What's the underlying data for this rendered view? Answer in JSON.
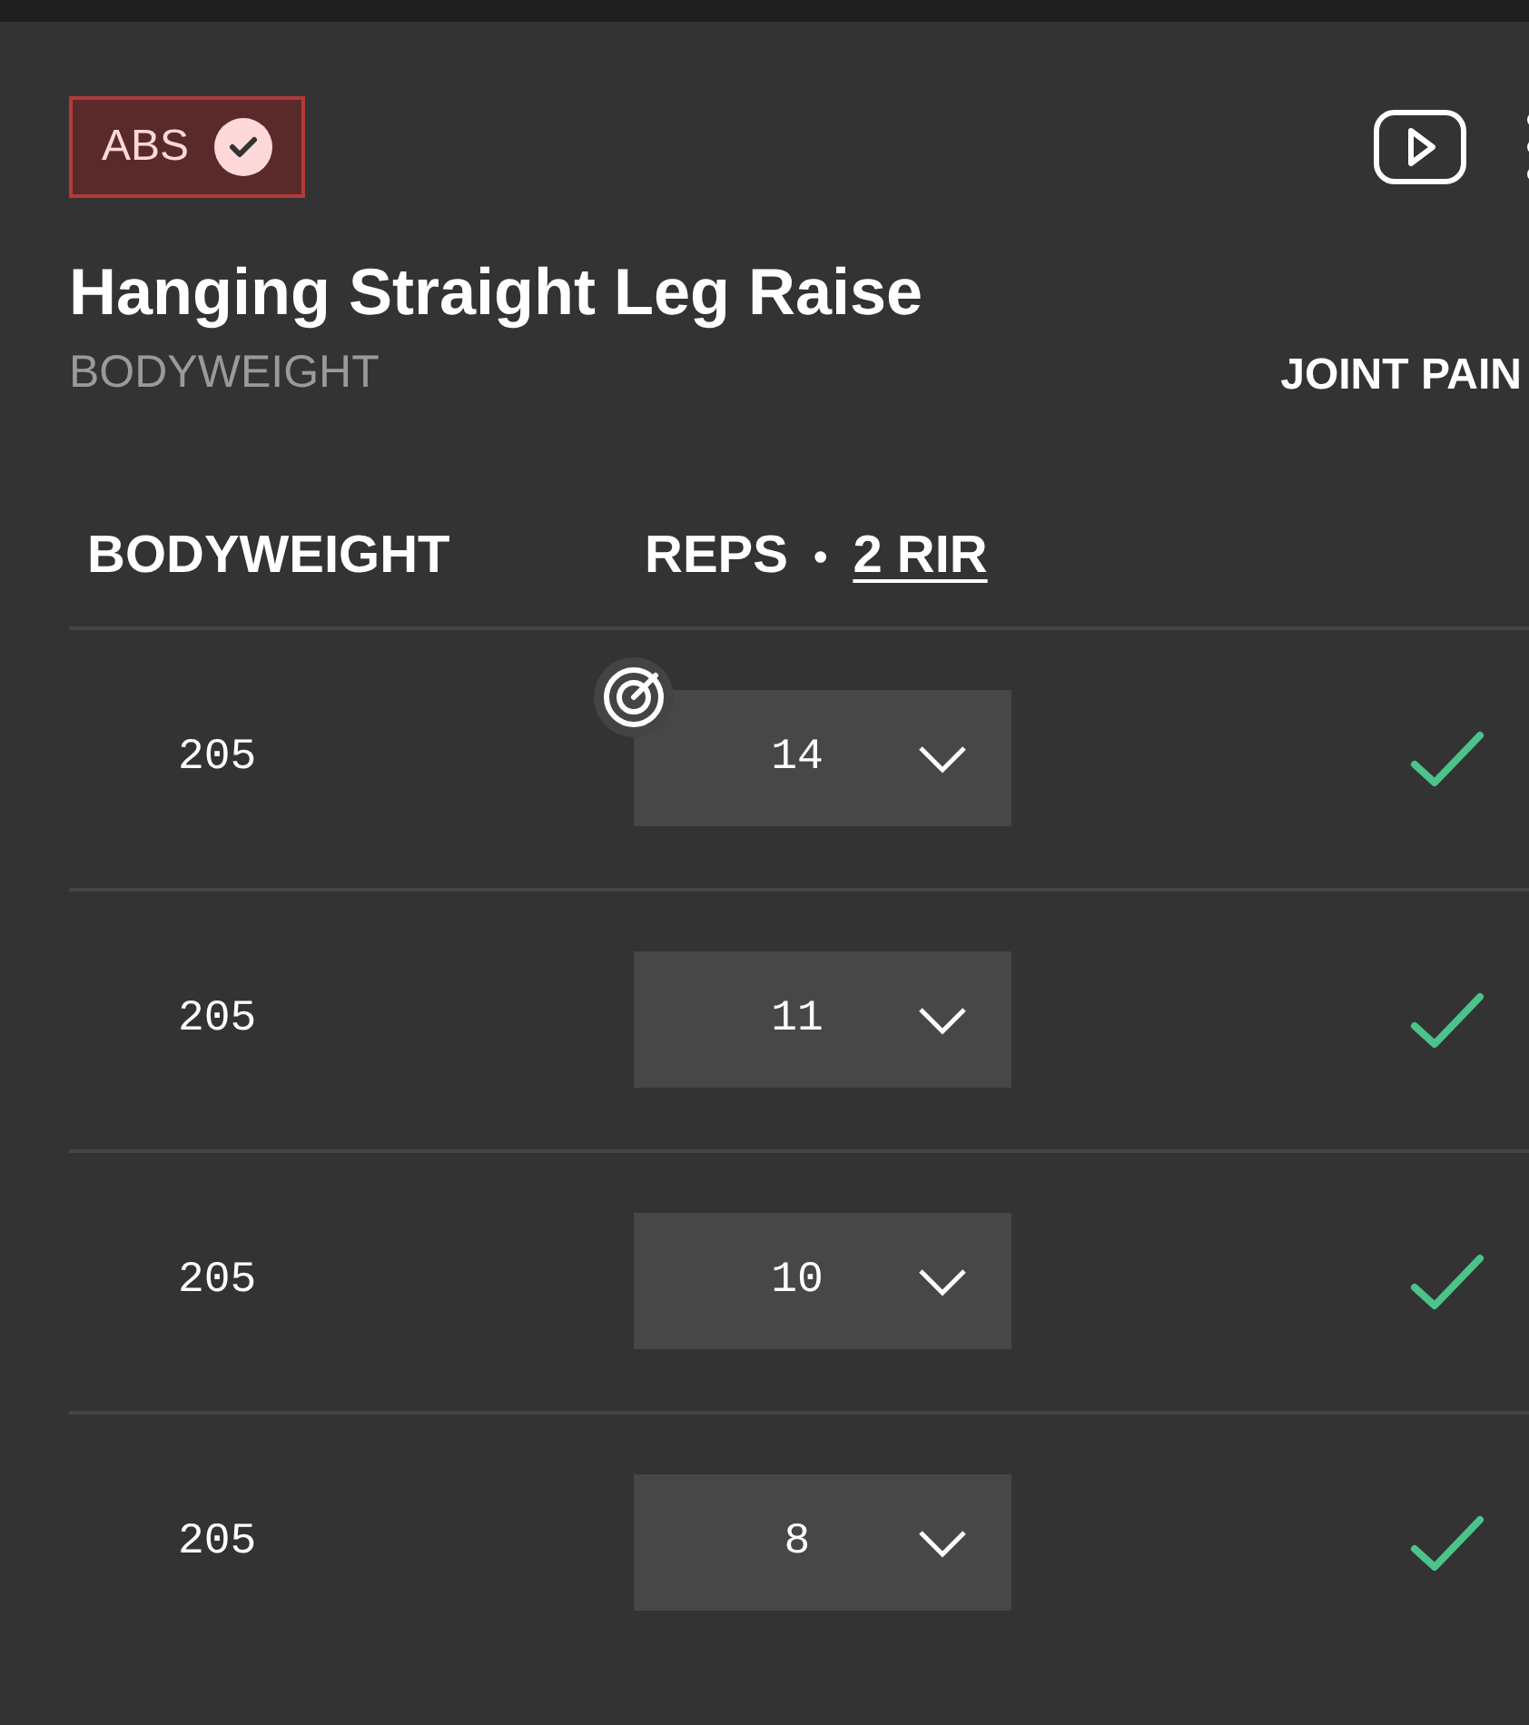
{
  "exercise": {
    "muscle_tag": {
      "label": "ABS",
      "checked": true
    },
    "name": "Hanging Straight Leg Raise",
    "equipment": "BODYWEIGHT",
    "joint_pain": "JOINT PAIN"
  },
  "columns": {
    "weight": "BODYWEIGHT",
    "reps": "REPS",
    "separator": "•",
    "rir": "2 RIR"
  },
  "sets": [
    {
      "weight": "205",
      "reps": "14",
      "target": true,
      "done": true
    },
    {
      "weight": "205",
      "reps": "11",
      "target": false,
      "done": true
    },
    {
      "weight": "205",
      "reps": "10",
      "target": false,
      "done": true
    },
    {
      "weight": "205",
      "reps": "8",
      "target": false,
      "done": true
    }
  ]
}
